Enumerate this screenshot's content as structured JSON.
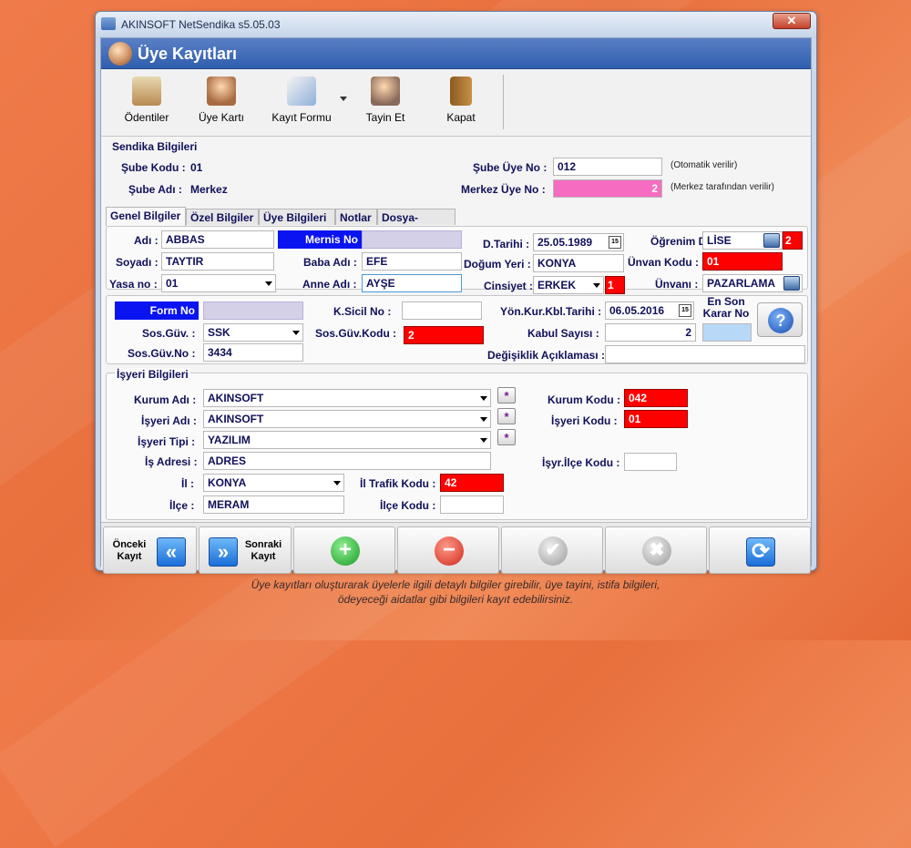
{
  "window": {
    "title": "AKINSOFT NetSendika s5.05.03",
    "close": "✕"
  },
  "header": {
    "title": "Üye Kayıtları"
  },
  "toolbar": {
    "items": [
      {
        "label": "Ödentiler",
        "icon": "payments-icon"
      },
      {
        "label": "Üye Kartı",
        "icon": "member-card-icon"
      },
      {
        "label": "Kayıt Formu",
        "icon": "registration-form-icon"
      },
      {
        "label": "Tayin Et",
        "icon": "assign-icon"
      },
      {
        "label": "Kapat",
        "icon": "exit-door-icon"
      }
    ]
  },
  "sendika": {
    "title": "Sendika Bilgileri",
    "sube_kodu_label": "Şube Kodu :",
    "sube_kodu": "01",
    "sube_adi_label": "Şube Adı :",
    "sube_adi": "Merkez",
    "sube_uye_no_label": "Şube Üye No :",
    "sube_uye_no": "012",
    "sube_uye_no_note": "(Otomatik verilir)",
    "merkez_uye_no_label": "Merkez Üye No :",
    "merkez_uye_no": "2",
    "merkez_uye_no_note": "(Merkez tarafından verilir)"
  },
  "tabs": [
    {
      "label": "Genel Bilgiler",
      "active": true
    },
    {
      "label": "Özel Bilgiler",
      "active": false
    },
    {
      "label": "Üye Bilgileri",
      "active": false
    },
    {
      "label": "Notlar",
      "active": false
    },
    {
      "label": "Dosya-Resim",
      "active": false
    }
  ],
  "genel": {
    "adi_label": "Adı :",
    "adi": "ABBAS",
    "soyadi_label": "Soyadı :",
    "soyadi": "TAYTIR",
    "yasa_no_label": "Yasa no :",
    "yasa_no": "01",
    "mernis_no_label": "Mernis No",
    "mernis_no": "",
    "baba_adi_label": "Baba Adı :",
    "baba_adi": "EFE",
    "anne_adi_label": "Anne Adı :",
    "anne_adi": "AYŞE",
    "d_tarihi_label": "D.Tarihi :",
    "d_tarihi": "25.05.1989",
    "dogum_yeri_label": "Doğum Yeri :",
    "dogum_yeri": "KONYA",
    "cinsiyet_label": "Cinsiyet :",
    "cinsiyet": "ERKEK",
    "cinsiyet_code": "1",
    "ogrenim_label": "Öğrenim D.:",
    "ogrenim": "LİSE",
    "ogrenim_code": "2",
    "unvan_kodu_label": "Ünvan Kodu :",
    "unvan_kodu": "01",
    "unvani_label": "Ünvanı :",
    "unvani": "PAZARLAMA",
    "calendar_glyph": "15"
  },
  "sosyal": {
    "form_no_label": "Form No",
    "form_no": "",
    "k_sicil_no_label": "K.Sicil No :",
    "k_sicil_no": "",
    "yon_kur_label": "Yön.Kur.Kbl.Tarihi :",
    "yon_kur": "06.05.2016",
    "en_son_karar_label": "En Son Karar No",
    "en_son_karar": "",
    "sos_guv_label": "Sos.Güv. :",
    "sos_guv": "SSK",
    "sos_guv_kodu_label": "Sos.Güv.Kodu :",
    "sos_guv_kodu": "2",
    "kabul_sayisi_label": "Kabul Sayısı :",
    "kabul_sayisi": "2",
    "sos_guv_no_label": "Sos.Güv.No :",
    "sos_guv_no": "3434",
    "degisiklik_label": "Değişiklik Açıklaması :",
    "degisiklik": "",
    "help_glyph": "?"
  },
  "isyeri": {
    "title": "İşyeri Bilgileri",
    "kurum_adi_label": "Kurum Adı :",
    "kurum_adi": "AKINSOFT",
    "isyeri_adi_label": "İşyeri Adı :",
    "isyeri_adi": "AKINSOFT",
    "isyeri_tipi_label": "İşyeri Tipi :",
    "isyeri_tipi": "YAZILIM",
    "is_adresi_label": "İş Adresi :",
    "is_adresi": "ADRES",
    "il_label": "İl :",
    "il": "KONYA",
    "ilce_label": "İlçe :",
    "ilce": "MERAM",
    "kurum_kodu_label": "Kurum Kodu :",
    "kurum_kodu": "042",
    "isyeri_kodu_label": "İşyeri Kodu :",
    "isyeri_kodu": "01",
    "isyr_ilce_kodu_label": "İşyr.İlçe Kodu :",
    "isyr_ilce_kodu": "",
    "il_trafik_kodu_label": "İl Trafik Kodu :",
    "il_trafik_kodu": "42",
    "ilce_kodu_label": "İlçe Kodu :",
    "ilce_kodu": "",
    "star": "*"
  },
  "nav": {
    "prev_label": "Önceki Kayıt",
    "prev_glyph": "«",
    "next_label": "Sonraki Kayıt",
    "next_glyph": "»",
    "add_glyph": "+",
    "delete_glyph": "−",
    "confirm_glyph": "✔",
    "cancel_glyph": "✖",
    "refresh_glyph": "⟳"
  },
  "caption": {
    "line1": "Üye kayıtları oluşturarak üyelerle ilgili detaylı bilgiler girebilir, üye tayini, istifa bilgileri,",
    "line2": "ödeyeceği aidatlar gibi bilgileri kayıt edebilirsiniz."
  }
}
